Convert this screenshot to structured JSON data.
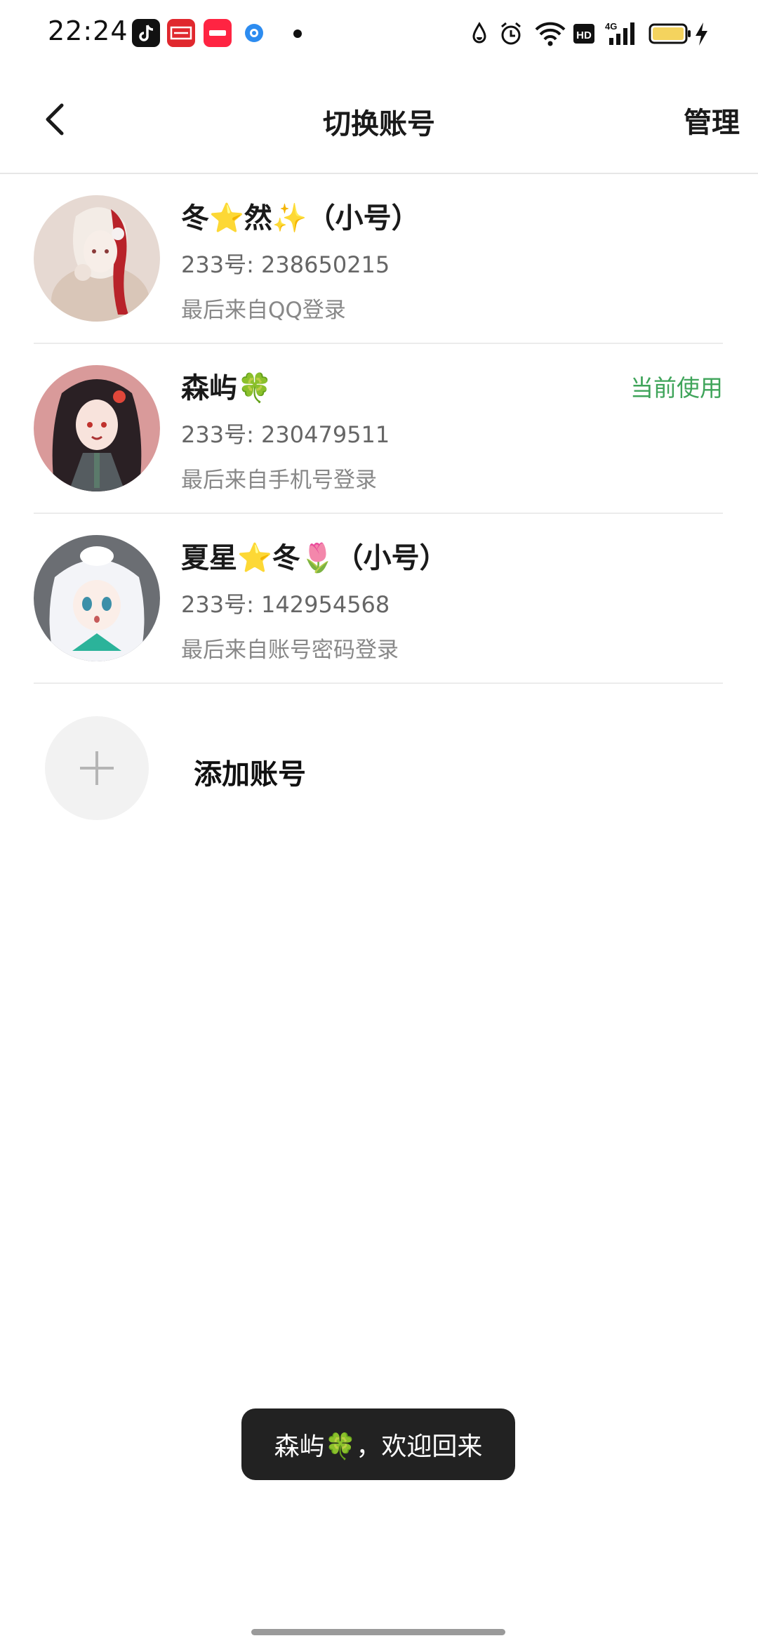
{
  "status_bar": {
    "time": "22:24",
    "apps": [
      "tiktok-icon",
      "toutiao-icon",
      "xiaohongshu-icon",
      "browser-icon"
    ],
    "indicators": [
      "water-drop-icon",
      "alarm-icon",
      "wifi-icon",
      "hd-icon",
      "signal-4g-icon",
      "battery-icon",
      "charging-icon"
    ]
  },
  "header": {
    "title": "切换账号",
    "manage_label": "管理"
  },
  "accounts": [
    {
      "name": "冬⭐然✨（小号）",
      "id_text": "233号: 238650215",
      "login_text": "最后来自QQ登录",
      "current": ""
    },
    {
      "name": "森屿🍀",
      "id_text": "233号: 230479511",
      "login_text": "最后来自手机号登录",
      "current": "当前使用"
    },
    {
      "name": "夏星⭐冬🌷（小号）",
      "id_text": "233号: 142954568",
      "login_text": "最后来自账号密码登录",
      "current": ""
    }
  ],
  "add_account": {
    "label": "添加账号"
  },
  "toast": {
    "text": "森屿🍀，欢迎回来"
  },
  "colors": {
    "current_green": "#3fa45a",
    "toast_bg": "#222222"
  }
}
